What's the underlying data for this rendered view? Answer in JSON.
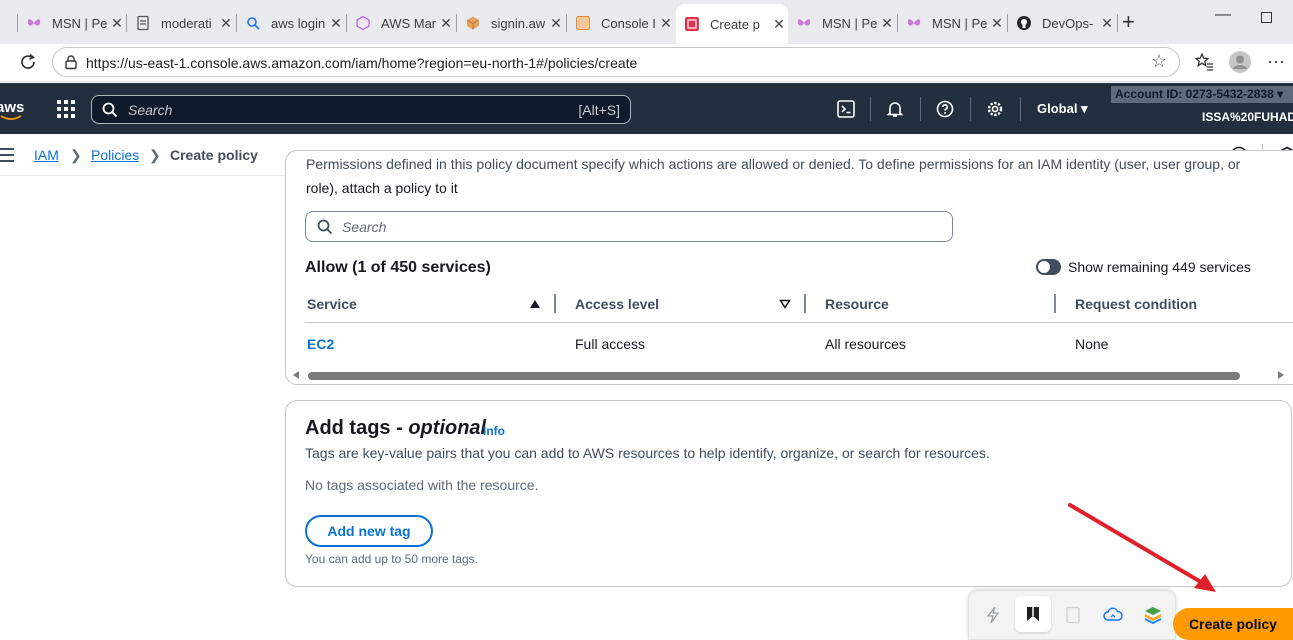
{
  "browser": {
    "tabs": [
      {
        "label": "MSN | Pe",
        "icon": "msn-butterfly-icon"
      },
      {
        "label": "moderati",
        "icon": "document-icon"
      },
      {
        "label": "aws login",
        "icon": "search-icon"
      },
      {
        "label": "AWS Mar",
        "icon": "cube-icon"
      },
      {
        "label": "signin.aw",
        "icon": "box-icon"
      },
      {
        "label": "Console I",
        "icon": "aws-console-icon"
      },
      {
        "label": "Create p",
        "icon": "aws-iam-icon"
      },
      {
        "label": "MSN | Pe",
        "icon": "msn-butterfly-icon"
      },
      {
        "label": "MSN | Pe",
        "icon": "msn-butterfly-icon"
      },
      {
        "label": "DevOps-",
        "icon": "github-icon"
      }
    ],
    "url": "https://us-east-1.console.aws.amazon.com/iam/home?region=eu-north-1#/policies/create"
  },
  "aws_header": {
    "logo": "aws",
    "search_placeholder": "Search",
    "search_hotkey": "[Alt+S]",
    "region": "Global ▾",
    "account": "Account ID: 0273-5432-2838 ▾",
    "user": "ISSA%20FUHAD"
  },
  "breadcrumb": {
    "items": [
      "IAM",
      "Policies",
      "Create policy"
    ]
  },
  "permissions": {
    "description_cut": "Permissions defined in this policy document specify which actions are allowed or denied. To define permissions for an IAM identity (user, user group, or",
    "description_end": "role), attach a policy to it",
    "search_placeholder": "Search",
    "allow_heading": "Allow (1 of 450 services)",
    "toggle_label": "Show remaining 449 services",
    "columns": [
      "Service",
      "Access level",
      "Resource",
      "Request condition"
    ],
    "rows": [
      {
        "service": "EC2",
        "access": "Full access",
        "resource": "All resources",
        "condition": "None"
      }
    ]
  },
  "tags": {
    "title": "Add tags - ",
    "title_optional": "optional",
    "info": "Info",
    "description": "Tags are key-value pairs that you can add to AWS resources to help identify, organize, or search for resources.",
    "empty_text": "No tags associated with the resource.",
    "add_button": "Add new tag",
    "limit_text": "You can add up to 50 more tags."
  },
  "footer": {
    "create_button": "Create policy"
  },
  "colors": {
    "aws_nav": "#232f3e",
    "link": "#0972d3",
    "primary_button": "#ff9900",
    "annotation_arrow": "#e0202a"
  }
}
